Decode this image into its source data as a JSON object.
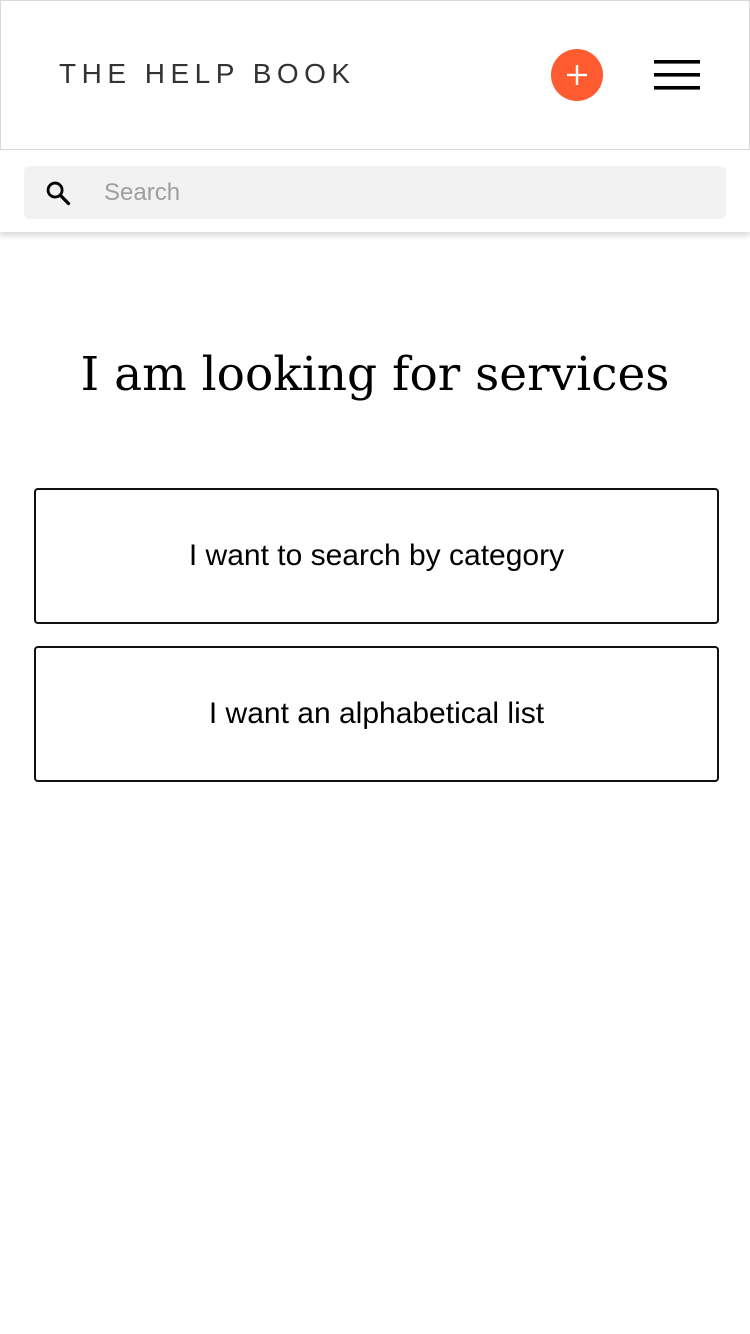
{
  "header": {
    "brand": "THE HELP BOOK",
    "add_icon": "plus-icon",
    "menu_icon": "hamburger-menu-icon",
    "accent_color": "#ff5b30"
  },
  "search": {
    "icon": "search-icon",
    "placeholder": "Search",
    "value": ""
  },
  "main": {
    "title": "I am looking for services",
    "options": [
      {
        "label": "I want to search by category"
      },
      {
        "label": "I want an alphabetical list"
      }
    ]
  }
}
